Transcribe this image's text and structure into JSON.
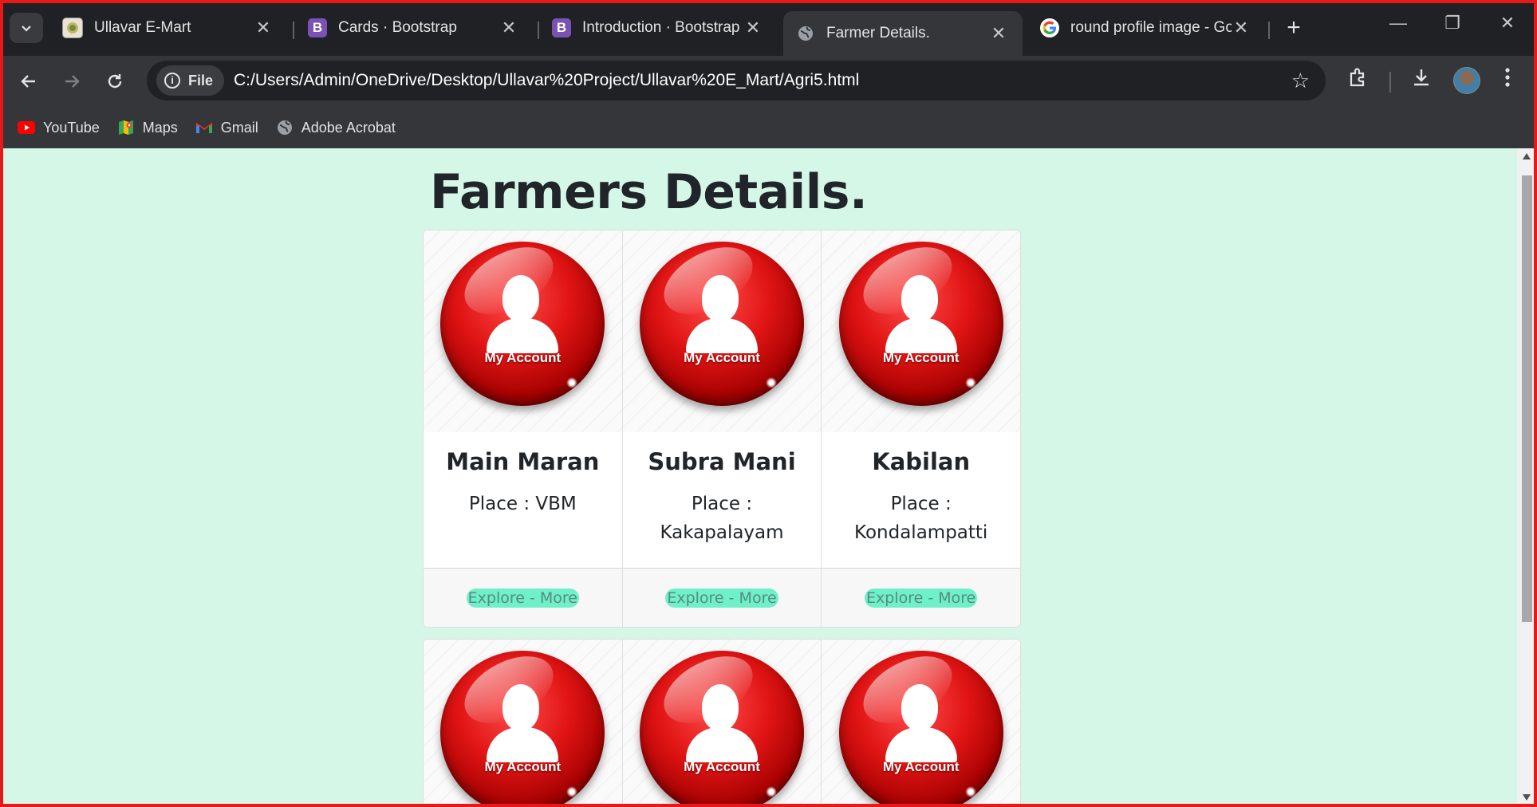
{
  "browser": {
    "tabs": [
      {
        "title": "Ullavar E-Mart",
        "favicon": "emblem-icon",
        "active": false
      },
      {
        "title": "Cards · Bootstrap",
        "favicon": "bootstrap-icon",
        "active": false
      },
      {
        "title": "Introduction · Bootstrap",
        "favicon": "bootstrap-icon",
        "active": false
      },
      {
        "title": "Farmer Details.",
        "favicon": "globe-icon",
        "active": true
      },
      {
        "title": "round profile image - Go",
        "favicon": "google-icon",
        "active": false
      }
    ],
    "site_chip": "File",
    "url": "C:/Users/Admin/OneDrive/Desktop/Ullavar%20Project/Ullavar%20E_Mart/Agri5.html",
    "bookmarks": [
      {
        "label": "YouTube",
        "icon": "youtube-icon"
      },
      {
        "label": "Maps",
        "icon": "maps-icon"
      },
      {
        "label": "Gmail",
        "icon": "gmail-icon"
      },
      {
        "label": "Adobe Acrobat",
        "icon": "globe-icon"
      }
    ],
    "accent_border": "#e81818"
  },
  "page": {
    "title": "Farmers Details.",
    "background": "#d5f7e7",
    "image_label": "My Account",
    "cards_row1": [
      {
        "name": "Main Maran",
        "place": "Place : VBM",
        "button": "Explore - More"
      },
      {
        "name": "Subra Mani",
        "place": "Place : Kakapalayam",
        "button": "Explore - More"
      },
      {
        "name": "Kabilan",
        "place": "Place : Kondalampatti",
        "button": "Explore - More"
      }
    ],
    "cards_row2": [
      {
        "image_label": "My Account"
      },
      {
        "image_label": "My Account"
      },
      {
        "image_label": "My Account"
      }
    ]
  }
}
